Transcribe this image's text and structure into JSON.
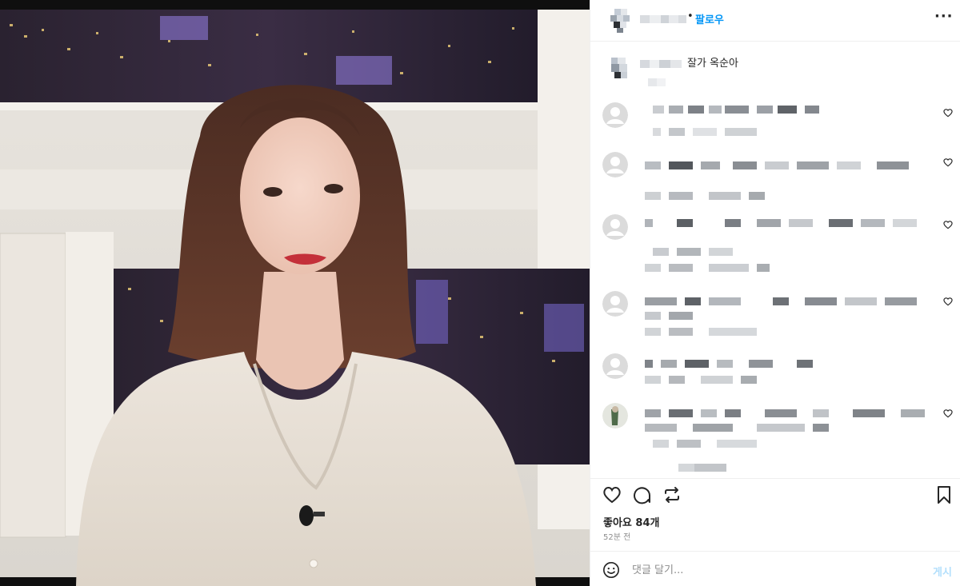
{
  "header": {
    "dot": "•",
    "follow_label": "팔로우",
    "more_label": "···"
  },
  "caption": {
    "text": "잘가 옥순아"
  },
  "comments_count_visible": 6,
  "actions": {
    "likes_label": "좋아요 84개",
    "time_label": "52분 전"
  },
  "comment_box": {
    "placeholder": "댓글 달기...",
    "post_label": "게시"
  },
  "colors": {
    "accent": "#0095f6",
    "post_disabled": "#b2dffc",
    "muted": "#8e8e8e",
    "divider": "#efefef"
  },
  "icons": [
    "heart-icon",
    "comment-bubble-icon",
    "share-icon",
    "bookmark-icon",
    "emoji-icon",
    "more-icon",
    "default-avatar-icon"
  ]
}
